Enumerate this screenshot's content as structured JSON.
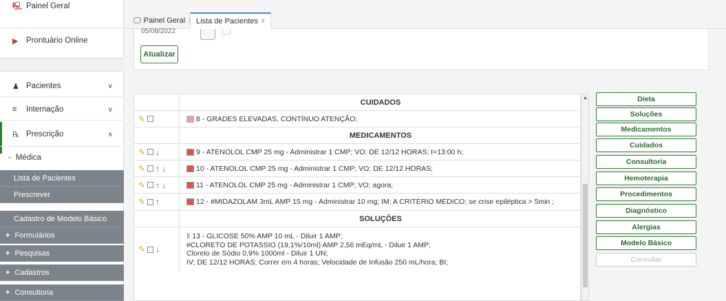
{
  "sidebar": {
    "items": [
      {
        "label": "Painel Geral",
        "icon": "monitor-icon"
      },
      {
        "label": "Prontuário Online",
        "icon": "folder-icon"
      },
      {
        "label": "Pacientes",
        "icon": "user-icon"
      },
      {
        "label": "Internação",
        "icon": "bed-icon"
      },
      {
        "label": "Prescrição",
        "icon": "prescription-icon"
      }
    ],
    "medica": "Médica",
    "sub_items": [
      "Lista de Pacientes",
      "Prescrever",
      "Cadastro de Modelo Básico"
    ],
    "plus_items": [
      "Formulários",
      "Pesquisas",
      "Cadastros",
      "Consultoria"
    ]
  },
  "tabs": [
    {
      "label": "Painel Geral",
      "close": "x"
    },
    {
      "label": "Lista de Pacientes",
      "close": "x"
    }
  ],
  "filters": {
    "date_fragment": "05/08/2022",
    "refresh_label": "Atualizar"
  },
  "table": {
    "sections": {
      "cuidados": "CUIDADOS",
      "medicamentos": "MEDICAMENTOS",
      "solucoes": "SOLUÇÕES"
    },
    "rows": {
      "r8": "8 - GRADES ELEVADAS, CONTÍNUO ATENÇÃO;",
      "r9": "9 - ATENOLOL CMP 25 mg - Administrar 1 CMP; VO; DE 12/12 HORAS; I=13:00 h;",
      "r10": "10 - ATENOLOL CMP 25 mg - Administrar 1 CMP; VO; DE 12/12 HORAS;",
      "r11": "11 - ATENOLOL CMP 25 mg - Administrar 1 CMP; VO; agora;",
      "r12": "12 - #MIDAZOLAM 3mL AMP 15 mg - Administrar 10 mg; IM; A CRITÉRIO MÉDICO; se crise epiléptica > 5min ;",
      "r13_l1": "13 - GLICOSE 50% AMP 10 mL - Diluir 1 AMP;",
      "r13_l2": "#CLORETO DE POTASSIO (19,1%/10ml) AMP 2,56 mEq/mL - Diluir 1 AMP;",
      "r13_l3": "Cloreto de Sódio 0,9% 1000ml - Diluir 1 UN;",
      "r13_l4": "IV; DE 12/12 HORAS; Correr em 4 horas; Velocidade de Infusão 250 mL/hora; BI;"
    }
  },
  "category_buttons": [
    "Dieta",
    "Soluções",
    "Medicamentos",
    "Cuidados",
    "Consultoria",
    "Hemoterapia",
    "Procedimentos",
    "Diagnóstico",
    "Alergias",
    "Modelo Básico",
    "Consultar"
  ],
  "colors": {
    "accent_green": "#2d7d2d",
    "sidebar_dark": "#7b848a",
    "tab_active": "#3a8dde"
  }
}
